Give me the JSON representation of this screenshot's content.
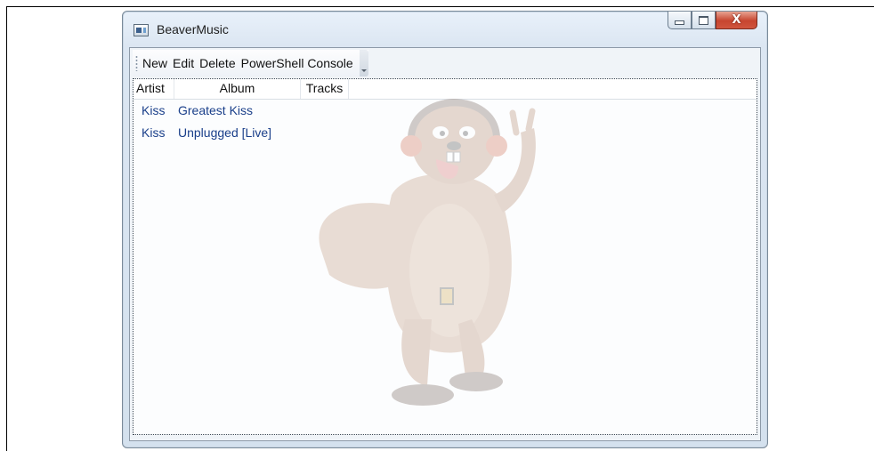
{
  "window": {
    "title": "BeaverMusic",
    "controls": {
      "minimize_icon": "minimize-icon",
      "maximize_icon": "maximize-icon",
      "close_label": "X"
    }
  },
  "toolbar": {
    "items": [
      "New",
      "Edit",
      "Delete",
      "PowerShell Console"
    ]
  },
  "list": {
    "columns": [
      "Artist",
      "Album",
      "Tracks"
    ],
    "rows": [
      {
        "artist": "Kiss",
        "album": "Greatest Kiss",
        "tracks": ""
      },
      {
        "artist": "Kiss",
        "album": "Unplugged [Live]",
        "tracks": ""
      }
    ]
  },
  "colors": {
    "row_text": "#1a3f8a",
    "watermark": "#a9876b",
    "close_button": "#c7452f"
  },
  "watermark_icon": "rocker-beaver-illustration"
}
